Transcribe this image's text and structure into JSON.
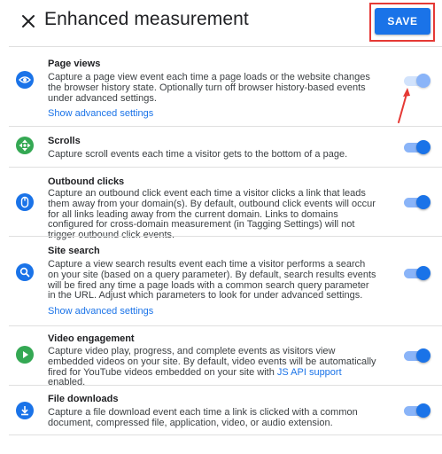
{
  "header": {
    "title": "Enhanced measurement",
    "save_label": "SAVE"
  },
  "colors": {
    "accent": "#1a73e8",
    "icon_blue": "#1a73e8",
    "icon_green": "#34a853",
    "highlight_red": "#e53935"
  },
  "items": [
    {
      "title": "Page views",
      "icon": "eye-icon",
      "description": "Capture a page view event each time a page loads or the website changes the browser history state. Optionally turn off browser history-based events under advanced settings.",
      "link": "Show advanced settings",
      "enabled": true
    },
    {
      "title": "Scrolls",
      "icon": "scroll-icon",
      "description": "Capture scroll events each time a visitor gets to the bottom of a page.",
      "enabled": true
    },
    {
      "title": "Outbound clicks",
      "icon": "mouse-icon",
      "description": "Capture an outbound click event each time a visitor clicks a link that leads them away from your domain(s). By default, outbound click events will occur for all links leading away from the current domain. Links to domains configured for cross-domain measurement (in Tagging Settings) will not trigger outbound click events.",
      "enabled": true
    },
    {
      "title": "Site search",
      "icon": "search-icon",
      "description": "Capture a view search results event each time a visitor performs a search on your site (based on a query parameter). By default, search results events will be fired any time a page loads with a common search query parameter in the URL. Adjust which parameters to look for under advanced settings.",
      "link": "Show advanced settings",
      "enabled": true
    },
    {
      "title": "Video engagement",
      "icon": "play-icon",
      "description_before": "Capture video play, progress, and complete events as visitors view embedded videos on your site. By default, video events will be automatically fired for YouTube videos embedded on your site with ",
      "description_link": "JS API support",
      "description_after": " enabled.",
      "enabled": true
    },
    {
      "title": "File downloads",
      "icon": "download-icon",
      "description": "Capture a file download event each time a link is clicked with a common document, compressed file, application, video, or audio extension.",
      "enabled": true
    }
  ]
}
